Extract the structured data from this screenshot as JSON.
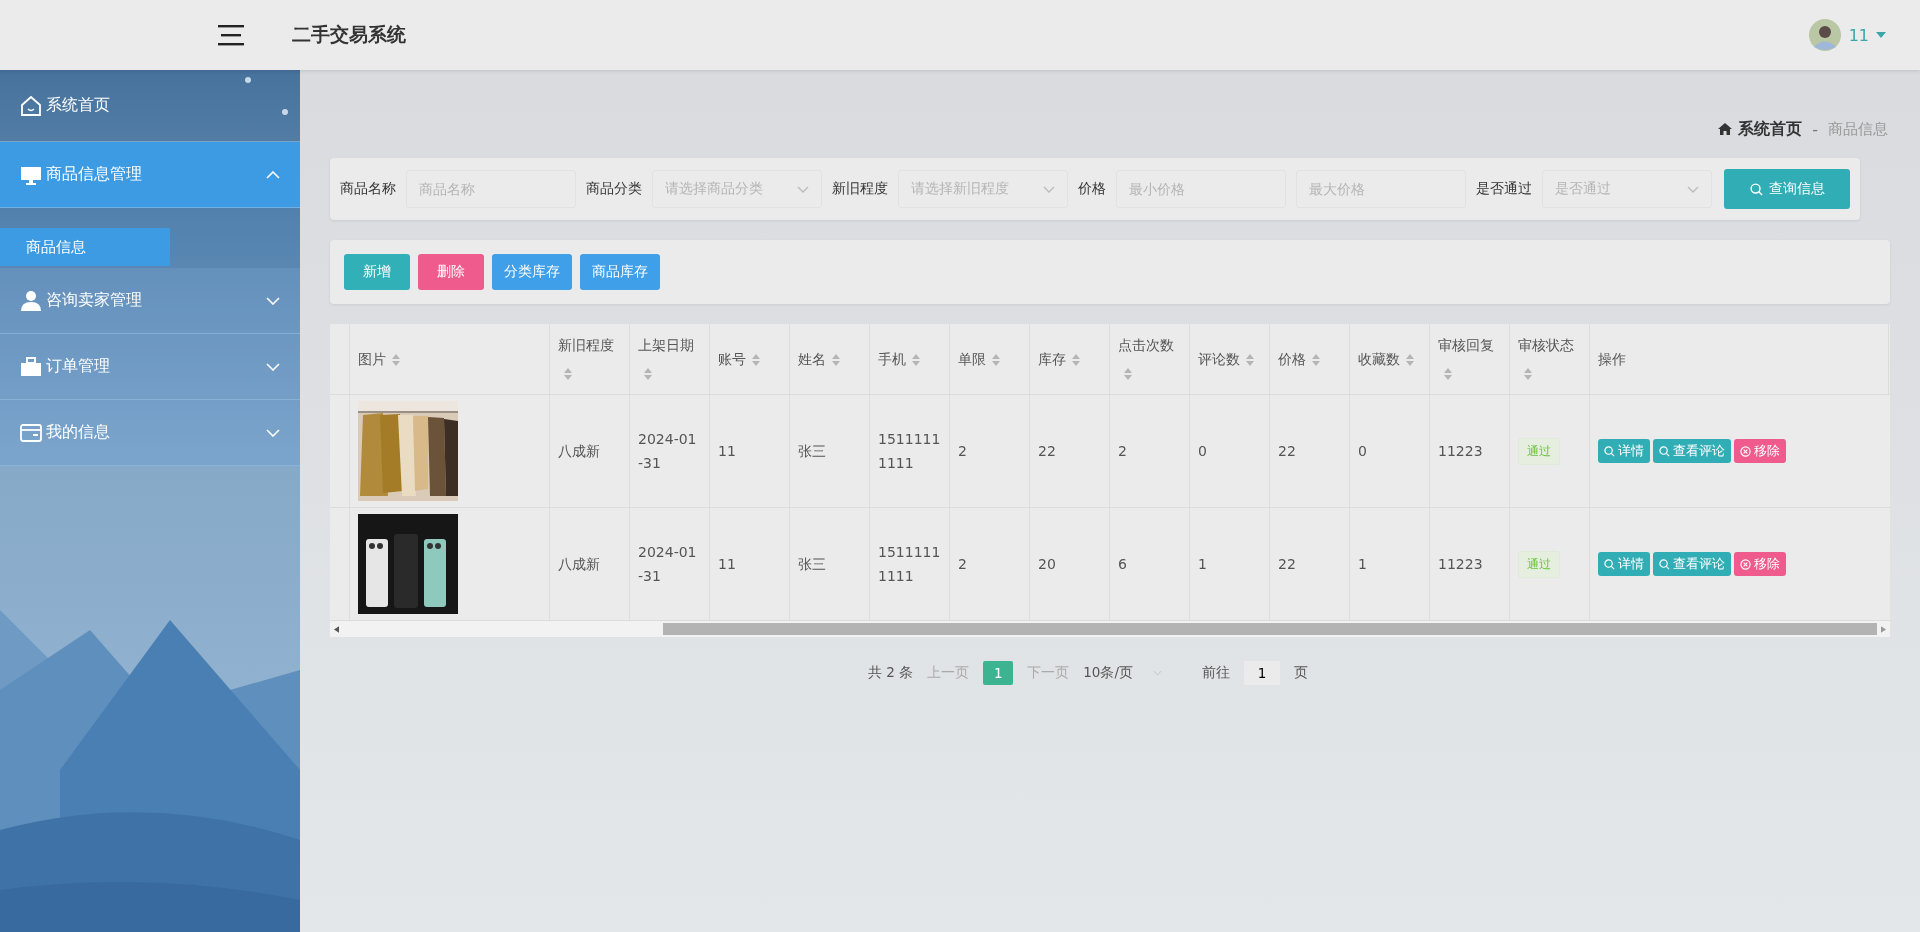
{
  "header": {
    "title": "二手交易系统",
    "user": {
      "name": "11"
    }
  },
  "sidebar": {
    "items": [
      {
        "label": "系统首页",
        "kind": "link"
      },
      {
        "label": "商品信息管理",
        "kind": "group",
        "expanded": true,
        "children": [
          {
            "label": "商品信息",
            "selected": true
          }
        ]
      },
      {
        "label": "咨询卖家管理",
        "kind": "group",
        "expanded": false
      },
      {
        "label": "订单管理",
        "kind": "group",
        "expanded": false
      },
      {
        "label": "我的信息",
        "kind": "group",
        "expanded": false
      }
    ]
  },
  "breadcrumb": {
    "items": [
      "系统首页",
      "商品信息"
    ],
    "separator": "-"
  },
  "filters": [
    {
      "label": "商品名称",
      "kind": "text",
      "placeholder": "商品名称"
    },
    {
      "label": "商品分类",
      "kind": "select",
      "placeholder": "请选择商品分类"
    },
    {
      "label": "新旧程度",
      "kind": "select",
      "placeholder": "请选择新旧程度"
    },
    {
      "label": "价格",
      "kind": "range",
      "placeholders": [
        "最小价格",
        "最大价格"
      ]
    },
    {
      "label": "是否通过",
      "kind": "select",
      "placeholder": "是否通过"
    }
  ],
  "search_button": "查询信息",
  "actions": [
    {
      "label": "新增",
      "color": "#31b0b8"
    },
    {
      "label": "删除",
      "color": "#ef5b8c"
    },
    {
      "label": "分类库存",
      "color": "#3f9fe8"
    },
    {
      "label": "商品库存",
      "color": "#3f9fe8"
    }
  ],
  "table": {
    "image_column": {
      "label": "图片",
      "sortable": true
    },
    "columns": [
      {
        "label": "新旧程度",
        "sortable": true
      },
      {
        "label": "上架日期",
        "sortable": true
      },
      {
        "label": "账号",
        "sortable": true
      },
      {
        "label": "姓名",
        "sortable": true
      },
      {
        "label": "手机",
        "sortable": true
      },
      {
        "label": "单限",
        "sortable": true
      },
      {
        "label": "库存",
        "sortable": true
      },
      {
        "label": "点击次数",
        "sortable": true
      },
      {
        "label": "评论数",
        "sortable": true
      },
      {
        "label": "价格",
        "sortable": true
      },
      {
        "label": "收藏数",
        "sortable": true
      },
      {
        "label": "审核回复",
        "sortable": true
      }
    ],
    "status_column": {
      "label": "审核状态",
      "sortable": true
    },
    "action_column": {
      "label": "操作",
      "sortable": false
    },
    "rows": [
      {
        "image": {
          "kind": "picture"
        },
        "cells": [
          "八成新",
          "2024-01-31",
          "11",
          "张三",
          "15111111111",
          "2",
          "22",
          "2",
          "0",
          "22",
          "0",
          "11223"
        ],
        "status": "通过",
        "operations": [
          {
            "label": "详情",
            "kind": "view"
          },
          {
            "label": "查看评论",
            "kind": "view"
          },
          {
            "label": "移除",
            "kind": "remove"
          }
        ]
      },
      {
        "image": {
          "kind": "picture"
        },
        "cells": [
          "八成新",
          "2024-01-31",
          "11",
          "张三",
          "15111111111",
          "2",
          "20",
          "6",
          "1",
          "22",
          "1",
          "11223"
        ],
        "status": "通过",
        "operations": [
          {
            "label": "详情",
            "kind": "view"
          },
          {
            "label": "查看评论",
            "kind": "view"
          },
          {
            "label": "移除",
            "kind": "remove"
          }
        ]
      }
    ]
  },
  "pagination": {
    "total": "共 2 条",
    "prev": "上一页",
    "pages": [
      {
        "label": "1",
        "selected": true
      }
    ],
    "next": "下一页",
    "page_size": "10条/页",
    "goto_label": "前往",
    "goto_value": "1",
    "goto_suffix": "页"
  }
}
